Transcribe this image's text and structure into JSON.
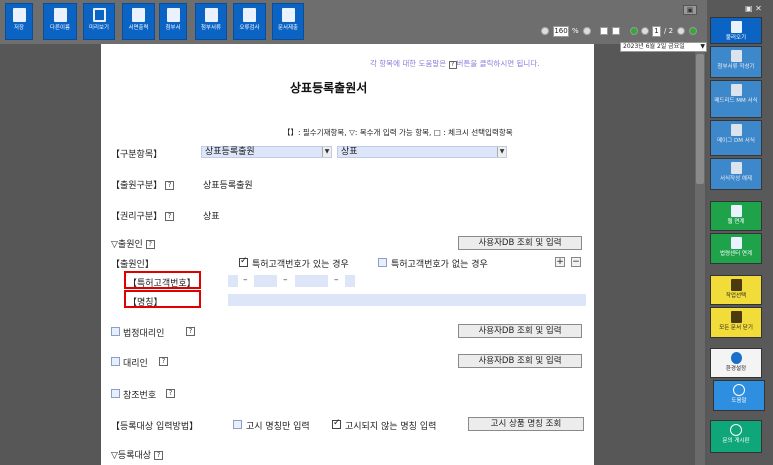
{
  "toolbar": {
    "items": [
      {
        "label": "저장",
        "icon": "save-icon"
      },
      {
        "label": "다른이름",
        "icon": "save-as-icon"
      },
      {
        "label": "미리보기",
        "icon": "preview-icon"
      },
      {
        "label": "서면출력",
        "icon": "print-icon"
      },
      {
        "label": "첨부서",
        "icon": "attach-icon"
      },
      {
        "label": "첨부서류",
        "icon": "attach-docs-icon"
      },
      {
        "label": "오류검사",
        "icon": "error-check-icon"
      },
      {
        "label": "문서제출",
        "icon": "submit-icon"
      }
    ]
  },
  "zoom": {
    "value": "160",
    "unit": "%"
  },
  "pager": {
    "current": "1",
    "total": "/ 2"
  },
  "date": "2023년  6월  2일 금요일",
  "doc": {
    "hint": {
      "before": "각 항목에 대한 도움말은",
      "q": "?",
      "after": "버튼을 클릭하시면 됩니다."
    },
    "title": "상표등록출원서",
    "legend": "【】: 필수기재항목,  ▽: 복수개 입력 가능 항목,  □ : 체크시 선택입력항목",
    "category": {
      "label": "【구분항목】",
      "sel1": "상표등록출원",
      "sel2": "상표"
    },
    "app_type": {
      "label": "【출원구분】",
      "value": "상표등록출원"
    },
    "right_type": {
      "label": "【권리구분】",
      "value": "상표"
    },
    "applicant": {
      "label": "▽출원인",
      "userdb": "사용자DB 조회 및 입력"
    },
    "applicant_sub": {
      "label": "【출원인】",
      "opt1": "특허고객번호가 있는 경우",
      "opt2": "특허고객번호가 없는 경우"
    },
    "customer_no": {
      "label": "【특허고객번호】",
      "dash": "–"
    },
    "name": {
      "label": "【명칭】"
    },
    "legal_agent": {
      "label": "법정대리인",
      "userdb": "사용자DB 조회 및 입력"
    },
    "agent": {
      "label": "대리인",
      "userdb": "사용자DB 조회 및 입력"
    },
    "ref_no": {
      "label": "참조번호"
    },
    "reg_method": {
      "label": "【등록대상 입력방법】",
      "opt1": "고시 명칭만 입력",
      "opt2": "고시되지 않는 명칭 입력",
      "button": "고시 상품 명칭 조회"
    },
    "reg_target": {
      "label": "▽등록대상"
    },
    "help_glyph": "?",
    "plus": "+",
    "minus": "−"
  },
  "sidebar": {
    "top": "▣  ✕",
    "items": [
      {
        "label": "불러오기",
        "icon": "open-icon"
      },
      {
        "label": "첨부서류 작성기",
        "icon": "attach-writer-icon"
      },
      {
        "label": "메드리드 MM 서식",
        "icon": "madrid-mm-icon"
      },
      {
        "label": "메이그 DM 서식",
        "icon": "hague-dm-icon"
      },
      {
        "label": "서식작성 예제",
        "icon": "example-icon"
      },
      {
        "label": "웹 연계",
        "icon": "web-link-icon"
      },
      {
        "label": "법령센터 연계",
        "icon": "law-center-icon"
      },
      {
        "label": "작업선택",
        "icon": "task-select-icon"
      },
      {
        "label": "모든 문서 닫기",
        "icon": "close-all-icon"
      },
      {
        "label": "환경설정",
        "icon": "settings-icon"
      },
      {
        "label": "도움말",
        "icon": "help-icon"
      },
      {
        "label": "문의 게시판",
        "icon": "inquiry-icon"
      }
    ]
  }
}
